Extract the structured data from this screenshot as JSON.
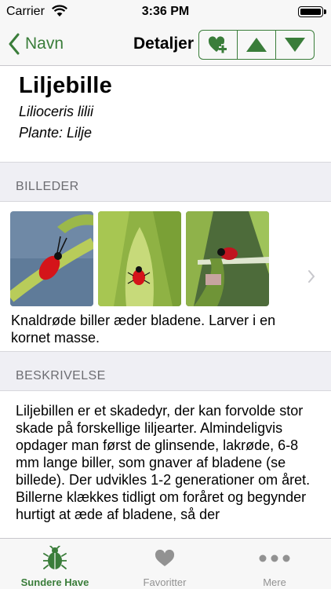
{
  "status": {
    "carrier": "Carrier",
    "time": "3:36 PM"
  },
  "nav": {
    "back_label": "Navn",
    "title": "Detaljer",
    "actions": [
      "heart-add-icon",
      "arrow-up-icon",
      "arrow-down-icon"
    ]
  },
  "header": {
    "title": "Liljebille",
    "latin": "Lilioceris lilii",
    "plant": "Plante: Lilje"
  },
  "images": {
    "section_title": "BILLEDER",
    "caption": "Knaldrøde  biller æder bladene. Larver i en kornet masse.",
    "thumb_count": 3
  },
  "description": {
    "section_title": "BESKRIVELSE",
    "text": "Liljebillen er et skadedyr, der kan forvolde stor skade på forskellige liljearter. Almindeligvis opdager man først de glinsende, lakrøde, 6-8 mm lange biller, som gnaver af bladene (se billede). Der udvikles 1-2 generationer om året.\nBillerne klækkes tidligt om foråret og begynder hurtigt at æde af bladene, så der"
  },
  "tabs": [
    {
      "label": "Sundere Have",
      "icon": "beetle-icon",
      "active": true
    },
    {
      "label": "Favoritter",
      "icon": "heart-icon",
      "active": false
    },
    {
      "label": "Mere",
      "icon": "more-icon",
      "active": false
    }
  ],
  "colors": {
    "accent": "#3a7d3a",
    "section_bg": "#efeff4",
    "bar_bg": "#f7f7f7",
    "inactive": "#929292"
  }
}
